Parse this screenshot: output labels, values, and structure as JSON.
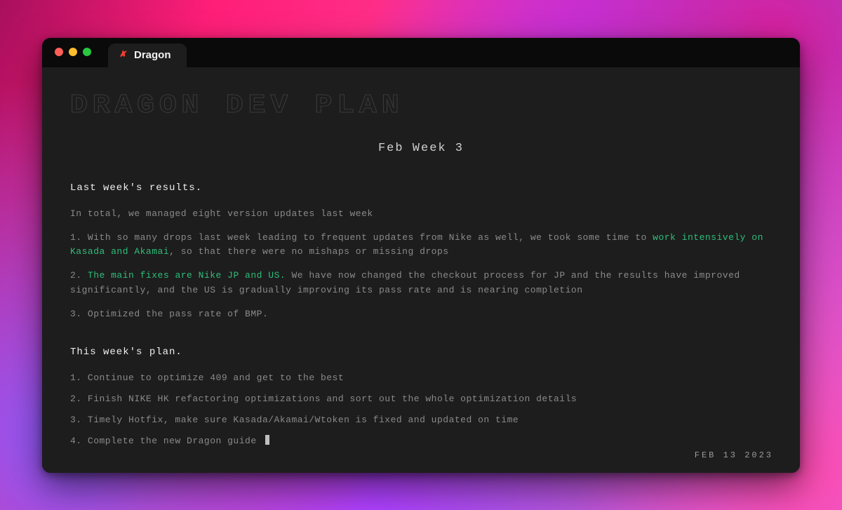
{
  "tab": {
    "title": "Dragon"
  },
  "page": {
    "title": "DRAGON DEV PLAN",
    "subtitle": "Feb Week 3"
  },
  "last_week": {
    "heading": "Last week's results.",
    "intro": "In total, we managed eight version updates last week",
    "items": [
      {
        "num": "1.",
        "pre": "With so many drops last week leading to frequent updates from Nike as well, we took some time to ",
        "hl": "work intensively on Kasada and Akamai",
        "post": ", so that there were no mishaps or missing drops"
      },
      {
        "num": "2.",
        "pre": "",
        "hl": "The main fixes are Nike JP and US.",
        "post": " We have now changed the checkout process for JP and the results have improved significantly, and the US is gradually improving its pass rate and is nearing completion"
      },
      {
        "num": "3.",
        "pre": "Optimized the pass rate of BMP.",
        "hl": "",
        "post": ""
      }
    ]
  },
  "this_week": {
    "heading": "This week's plan.",
    "items": [
      "1. Continue to optimize 409 and get to the best",
      "2. Finish NIKE HK refactoring optimizations and sort out the whole optimization details",
      "3. Timely Hotfix, make sure Kasada/Akamai/Wtoken is fixed and updated on time",
      "4. Complete the new Dragon guide"
    ]
  },
  "footer": {
    "date": "FEB 13 2023"
  }
}
